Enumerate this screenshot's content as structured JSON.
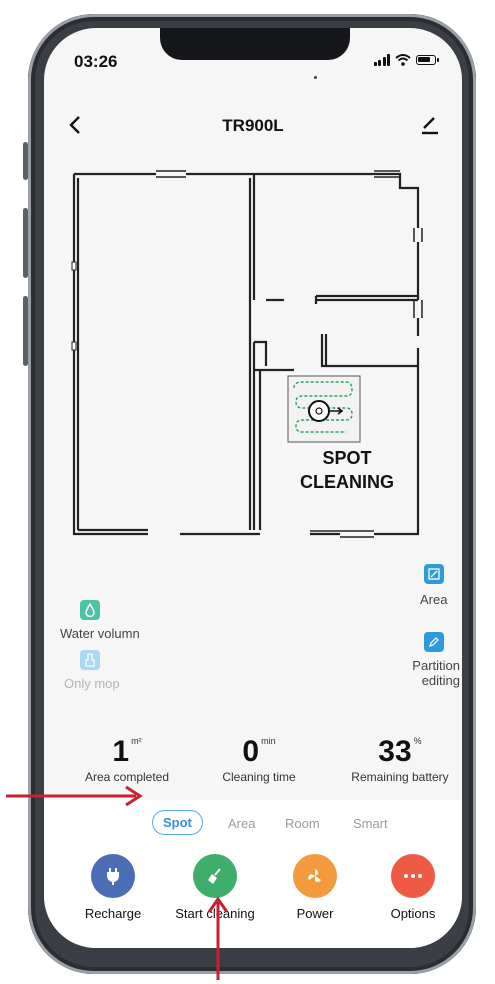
{
  "status_bar": {
    "time": "03:26"
  },
  "header": {
    "title": "TR900L"
  },
  "map": {
    "spot_label_line1": "SPOT",
    "spot_label_line2": "CLEANING"
  },
  "tools_left": [
    {
      "label": "Water volumn",
      "icon": "water-drop-icon",
      "color": "#4cc3a7"
    },
    {
      "label": "Only mop",
      "icon": "mop-icon",
      "color": "#a9d8f2"
    }
  ],
  "tools_right": [
    {
      "label": "Area",
      "icon": "area-select-icon",
      "color": "#2f9ad9"
    },
    {
      "label_line1": "Partition",
      "label_line2": "editing",
      "icon": "partition-edit-icon",
      "color": "#2f9ad9"
    }
  ],
  "stats": {
    "area": {
      "value": "1",
      "unit": "m²",
      "label": "Area completed"
    },
    "time": {
      "value": "0",
      "unit": "min",
      "label": "Cleaning time"
    },
    "battery": {
      "value": "33",
      "unit": "%",
      "label": "Remaining battery"
    }
  },
  "modes": [
    {
      "label": "Spot",
      "active": true
    },
    {
      "label": "Area",
      "active": false
    },
    {
      "label": "Room",
      "active": false
    },
    {
      "label": "Smart",
      "active": false
    }
  ],
  "actions": [
    {
      "label": "Recharge",
      "icon": "plug-icon",
      "color": "#4a6db5"
    },
    {
      "label": "Start cleaning",
      "icon": "broom-icon",
      "color": "#3fae6a"
    },
    {
      "label": "Power",
      "icon": "fan-icon",
      "color": "#f39a3c"
    },
    {
      "label": "Options",
      "icon": "more-dots-icon",
      "color": "#ee5a43"
    }
  ],
  "colors": {
    "accent": "#3a8ede",
    "annotation_arrow": "#c8202f"
  }
}
